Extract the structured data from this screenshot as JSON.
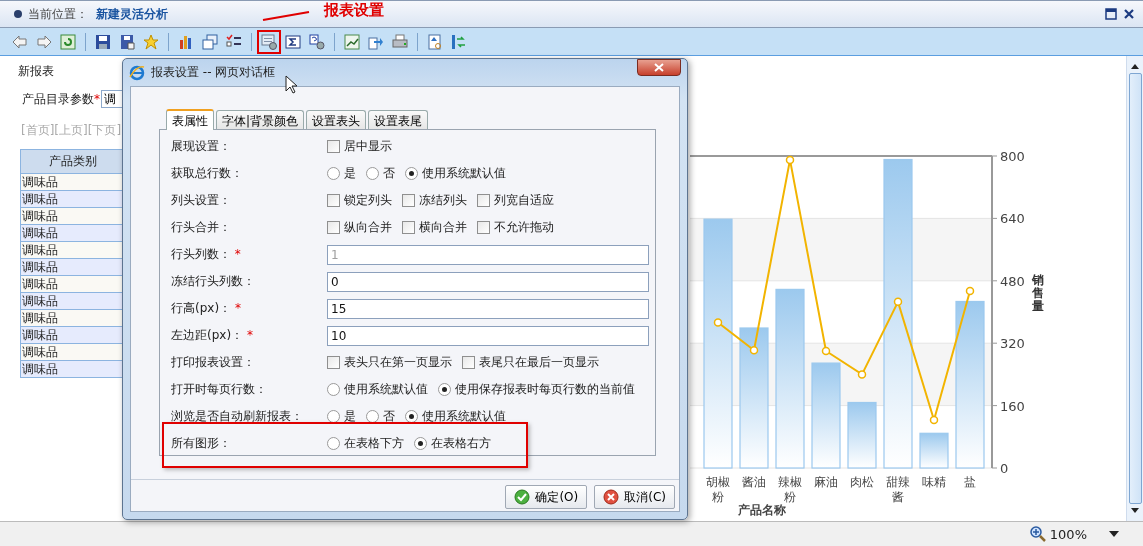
{
  "header": {
    "location_label": "当前位置：",
    "location": "新建灵活分析",
    "window_buttons": [
      {
        "kind": "maximize"
      },
      {
        "kind": "close"
      }
    ]
  },
  "annotation": {
    "label": "报表设置"
  },
  "toolbar": {
    "buttons": [
      {
        "kind": "arrow-left",
        "framed": false
      },
      {
        "kind": "arrow-right",
        "framed": false
      },
      {
        "kind": "refresh",
        "framed": false
      },
      {
        "kind": "separator"
      },
      {
        "kind": "save",
        "framed": false
      },
      {
        "kind": "save-as",
        "framed": false
      },
      {
        "kind": "star",
        "framed": false
      },
      {
        "kind": "separator"
      },
      {
        "kind": "bar-chart",
        "framed": false
      },
      {
        "kind": "windows",
        "framed": false
      },
      {
        "kind": "checklist",
        "framed": false
      },
      {
        "kind": "separator"
      },
      {
        "kind": "settings",
        "framed": true
      },
      {
        "kind": "sigma",
        "framed": false
      },
      {
        "kind": "help-gear",
        "framed": false
      },
      {
        "kind": "separator"
      },
      {
        "kind": "excel",
        "framed": false
      },
      {
        "kind": "export",
        "framed": false
      },
      {
        "kind": "print",
        "framed": false
      },
      {
        "kind": "separator"
      },
      {
        "kind": "preview",
        "framed": false
      },
      {
        "kind": "swap",
        "framed": false
      }
    ]
  },
  "report": {
    "title": "新报表",
    "param_label": "产品目录参数",
    "param_marker": "*",
    "param_value": "调",
    "pager": "[首页][上页][下页]",
    "table": {
      "columns": [
        "产品类别"
      ],
      "rows": [
        [
          "调味品"
        ],
        [
          "调味品"
        ],
        [
          "调味品"
        ],
        [
          "调味品"
        ],
        [
          "调味品"
        ],
        [
          "调味品"
        ],
        [
          "调味品"
        ],
        [
          "调味品"
        ],
        [
          "调味品"
        ],
        [
          "调味品"
        ],
        [
          "调味品"
        ],
        [
          "调味品"
        ]
      ]
    }
  },
  "chart": {
    "chart_data": {
      "type": "bar",
      "xlabel": "产品名称",
      "ylabel": "销售量",
      "categories": [
        "胡椒粉",
        "酱油",
        "辣椒粉",
        "麻油",
        "肉松",
        "甜辣酱",
        "味精",
        "盐"
      ],
      "series": [
        {
          "type": "bar",
          "color": "#9cc9ee",
          "values": [
            638,
            359,
            458,
            269,
            168,
            791,
            89,
            427
          ]
        },
        {
          "type": "line",
          "color": "#f2b400",
          "marker": "circle",
          "values": [
            373,
            302,
            790,
            300,
            240,
            426,
            123,
            454
          ]
        }
      ],
      "grid": true,
      "ylim": [
        0,
        800
      ],
      "yticks": [
        {
          "value": 0,
          "label": "0"
        },
        {
          "value": 160,
          "label": "160"
        },
        {
          "value": 320,
          "label": "320"
        },
        {
          "value": 480,
          "label": "480"
        },
        {
          "value": 640,
          "label": "640"
        },
        {
          "value": 800,
          "label": "800"
        }
      ]
    }
  },
  "dialog": {
    "title": "报表设置 -- 网页对话框",
    "tabs": [
      {
        "label": "表属性",
        "selected": true
      },
      {
        "label": "字体|背景颜色",
        "selected": false
      },
      {
        "label": "设置表头",
        "selected": false
      },
      {
        "label": "设置表尾",
        "selected": false
      }
    ],
    "rows": [
      {
        "kind": "checks",
        "label": "展现设置：",
        "highlighted": false,
        "options": [
          {
            "label": "居中显示",
            "checked": false
          }
        ]
      },
      {
        "kind": "radios",
        "label": "获取总行数：",
        "highlighted": false,
        "options": [
          {
            "label": "是",
            "selected": false
          },
          {
            "label": "否",
            "selected": false
          },
          {
            "label": "使用系统默认值",
            "selected": true
          }
        ]
      },
      {
        "kind": "checks",
        "label": "列头设置：",
        "highlighted": false,
        "options": [
          {
            "label": "锁定列头",
            "checked": false
          },
          {
            "label": "冻结列头",
            "checked": false
          },
          {
            "label": "列宽自适应",
            "checked": false
          }
        ]
      },
      {
        "kind": "checks",
        "label": "行头合并：",
        "highlighted": false,
        "options": [
          {
            "label": "纵向合并",
            "checked": false
          },
          {
            "label": "横向合并",
            "checked": false
          },
          {
            "label": "不允许拖动",
            "checked": false
          }
        ]
      },
      {
        "kind": "input",
        "label": "行头列数：",
        "marker": "*",
        "value": "1",
        "disabled": true,
        "highlighted": false
      },
      {
        "kind": "input",
        "label": "冻结行头列数：",
        "value": "0",
        "disabled": false,
        "highlighted": false
      },
      {
        "kind": "input",
        "label": "行高(px)：",
        "marker": "*",
        "value": "15",
        "disabled": false,
        "highlighted": false
      },
      {
        "kind": "input",
        "label": "左边距(px)：",
        "marker": "*",
        "value": "10",
        "disabled": false,
        "highlighted": false
      },
      {
        "kind": "checks",
        "label": "打印报表设置：",
        "highlighted": false,
        "options": [
          {
            "label": "表头只在第一页显示",
            "checked": false
          },
          {
            "label": "表尾只在最后一页显示",
            "checked": false
          }
        ]
      },
      {
        "kind": "radios",
        "label": "打开时每页行数：",
        "highlighted": false,
        "options": [
          {
            "label": "使用系统默认值",
            "selected": false
          },
          {
            "label": "使用保存报表时每页行数的当前值",
            "selected": true
          }
        ]
      },
      {
        "kind": "radios",
        "label": "浏览是否自动刷新报表：",
        "highlighted": false,
        "options": [
          {
            "label": "是",
            "selected": false
          },
          {
            "label": "否",
            "selected": false
          },
          {
            "label": "使用系统默认值",
            "selected": true
          }
        ]
      },
      {
        "kind": "radios",
        "label": "所有图形：",
        "highlighted": true,
        "options": [
          {
            "label": "在表格下方",
            "selected": false
          },
          {
            "label": "在表格右方",
            "selected": true
          }
        ]
      }
    ],
    "buttons": [
      {
        "kind": "ok",
        "label": "确定(O)"
      },
      {
        "kind": "cancel",
        "label": "取消(C)"
      }
    ]
  },
  "status_bar": {
    "zoom": "100%"
  }
}
